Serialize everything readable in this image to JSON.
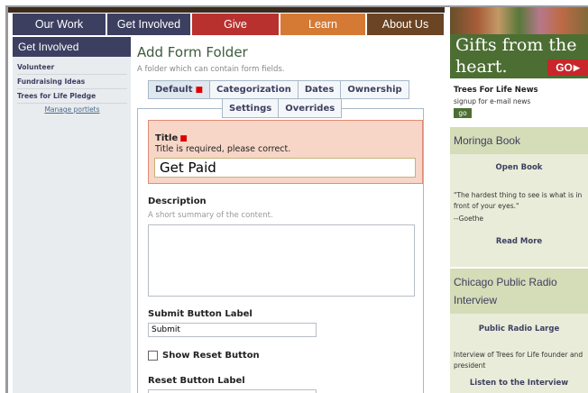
{
  "nav": {
    "items": [
      {
        "label": "Our Work",
        "color": "#3d3f61",
        "width": 105
      },
      {
        "label": "Get Involved",
        "color": "#3d3f61",
        "width": 94
      },
      {
        "label": "Give",
        "color": "#b8312f",
        "width": 98
      },
      {
        "label": "Learn",
        "color": "#d57a34",
        "width": 96
      },
      {
        "label": "About Us",
        "color": "#6b4424",
        "width": 85
      }
    ]
  },
  "sidebar": {
    "heading": "Get Involved",
    "items": [
      {
        "label": "Volunteer"
      },
      {
        "label": "Fundraising Ideas"
      },
      {
        "label": "Trees for Life Pledge"
      }
    ],
    "manage_label": "Manage portlets"
  },
  "main": {
    "title": "Add Form Folder",
    "description": "A folder which can contain form fields.",
    "tabs_row1": [
      {
        "label": "Default",
        "active": true,
        "has_error": true
      },
      {
        "label": "Categorization",
        "active": false,
        "has_error": false
      },
      {
        "label": "Dates",
        "active": false,
        "has_error": false
      },
      {
        "label": "Ownership",
        "active": false,
        "has_error": false
      }
    ],
    "tabs_row2": [
      {
        "label": "Settings"
      },
      {
        "label": "Overrides"
      }
    ],
    "title_field": {
      "label": "Title",
      "error": "Title is required, please correct.",
      "value": "Get Paid"
    },
    "description_field": {
      "label": "Description",
      "help": "A short summary of the content.",
      "value": ""
    },
    "submit_field": {
      "label": "Submit Button Label",
      "value": "Submit"
    },
    "reset_checkbox": {
      "label": "Show Reset Button",
      "checked": false
    },
    "reset_field": {
      "label": "Reset Button Label"
    }
  },
  "right": {
    "gift_banner": {
      "line1": "Gifts from the",
      "line2": "heart.",
      "go_label": "GO"
    },
    "news": {
      "title": "Trees For Life News",
      "subtitle": "signup for e-mail news",
      "go_label": "go"
    },
    "moringa": {
      "heading": "Moringa Book",
      "link": "Open Book",
      "quote": "\"The hardest thing to see is what is in front of your eyes.\"",
      "author": "--Goethe",
      "read_more": "Read More"
    },
    "radio": {
      "heading": "Chicago Public Radio Interview",
      "link": "Public Radio Large",
      "text": "Interview of Trees for Life founder and president",
      "listen": "Listen to the Interview"
    }
  }
}
